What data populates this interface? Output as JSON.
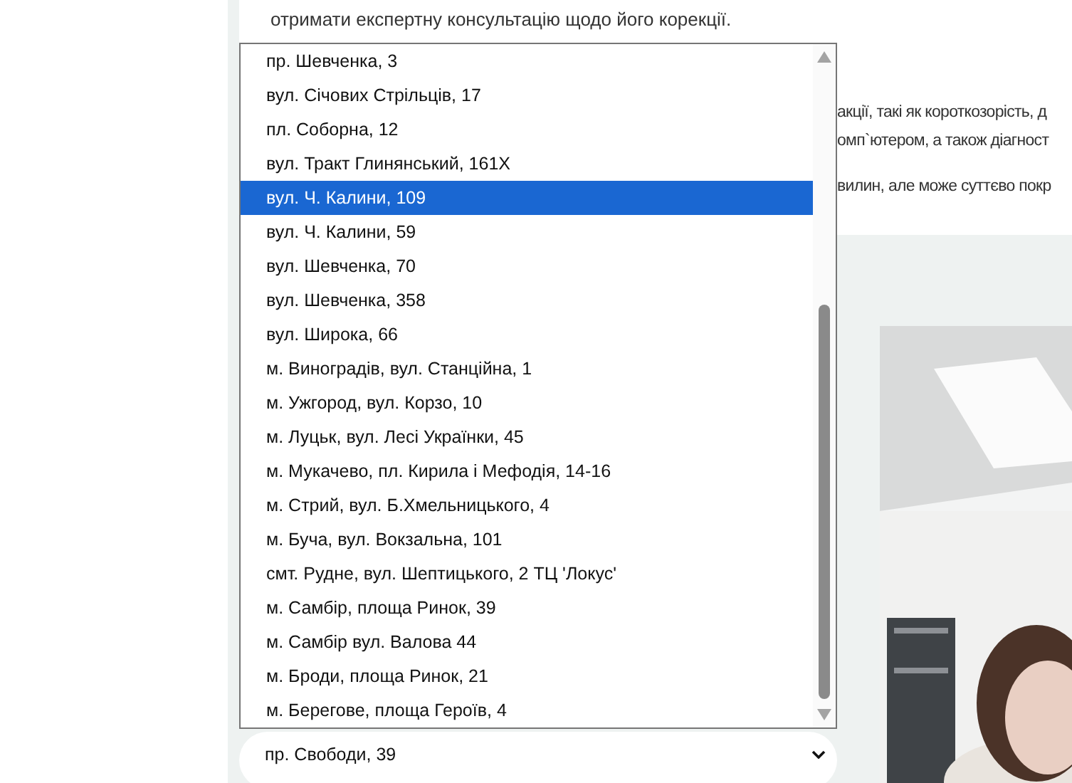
{
  "intro": {
    "text": "отримати експертну консультацію щодо його корекції."
  },
  "fragments": [
    "акції, такі як короткозорість, д",
    "омп`ютером, а також діагност",
    "вилин, але може суттєво покр"
  ],
  "dropdown": {
    "options": [
      {
        "label": "пр. Шевченка, 3",
        "selected": false
      },
      {
        "label": "вул. Січових Стрільців, 17",
        "selected": false
      },
      {
        "label": "пл. Соборна, 12",
        "selected": false
      },
      {
        "label": "вул. Тракт Глинянський, 161Х",
        "selected": false
      },
      {
        "label": "вул. Ч. Калини, 109",
        "selected": true
      },
      {
        "label": "вул. Ч. Калини, 59",
        "selected": false
      },
      {
        "label": "вул. Шевченка, 70",
        "selected": false
      },
      {
        "label": "вул. Шевченка, 358",
        "selected": false
      },
      {
        "label": "вул. Широка, 66",
        "selected": false
      },
      {
        "label": "м. Виноградів, вул. Станційна, 1",
        "selected": false
      },
      {
        "label": "м. Ужгород, вул. Корзо, 10",
        "selected": false
      },
      {
        "label": "м. Луцьк, вул. Лесі Українки, 45",
        "selected": false
      },
      {
        "label": "м. Мукачево, пл. Кирила і Мефодія, 14-16",
        "selected": false
      },
      {
        "label": "м. Стрий, вул. Б.Хмельницького, 4",
        "selected": false
      },
      {
        "label": "м. Буча, вул. Вокзальна, 101",
        "selected": false
      },
      {
        "label": "смт. Рудне, вул. Шептицького, 2 ТЦ 'Локус'",
        "selected": false
      },
      {
        "label": "м. Самбір, площа Ринок, 39",
        "selected": false
      },
      {
        "label": "м. Самбір вул. Валова 44",
        "selected": false
      },
      {
        "label": "м. Броди, площа Ринок, 21",
        "selected": false
      },
      {
        "label": "м. Берегове, площа Героїв, 4",
        "selected": false
      }
    ]
  },
  "select": {
    "value": "пр. Свободи, 39"
  }
}
